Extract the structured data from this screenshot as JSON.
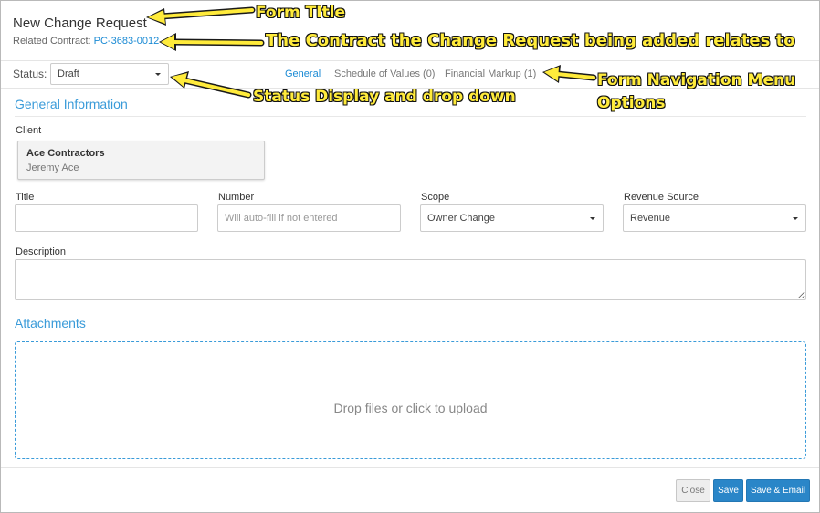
{
  "modal": {
    "title": "New Change Request",
    "related_label": "Related Contract: ",
    "related_link": "PC-3683-0012"
  },
  "status": {
    "label": "Status:",
    "value": "Draft"
  },
  "nav": [
    {
      "label": "General",
      "active": true
    },
    {
      "label": "Schedule of Values (0)",
      "active": false
    },
    {
      "label": "Financial Markup (1)",
      "active": false
    }
  ],
  "general": {
    "section_title": "General Information",
    "client_label": "Client",
    "client_name": "Ace Contractors",
    "client_contact": "Jeremy Ace",
    "title_label": "Title",
    "title_value": "",
    "number_label": "Number",
    "number_placeholder": "Will auto-fill if not entered",
    "scope_label": "Scope",
    "scope_value": "Owner Change",
    "revenue_label": "Revenue Source",
    "revenue_value": "Revenue",
    "description_label": "Description",
    "description_value": ""
  },
  "attachments": {
    "section_title": "Attachments",
    "dropzone_text": "Drop files or click to upload"
  },
  "footer": {
    "close_label": "Close",
    "save_label": "Save",
    "save_email_label": "Save & Email"
  },
  "annotations": {
    "form_title": "Form TItle",
    "contract": "The Contract the Change Request being added relates to",
    "status": "Status Display and drop down",
    "nav_line1": "Form Navigation Menu",
    "nav_line2": "Options"
  },
  "colors": {
    "accent": "#1a8ad4",
    "primary_button": "#2a86c8",
    "annotation": "#ffeb3b"
  }
}
